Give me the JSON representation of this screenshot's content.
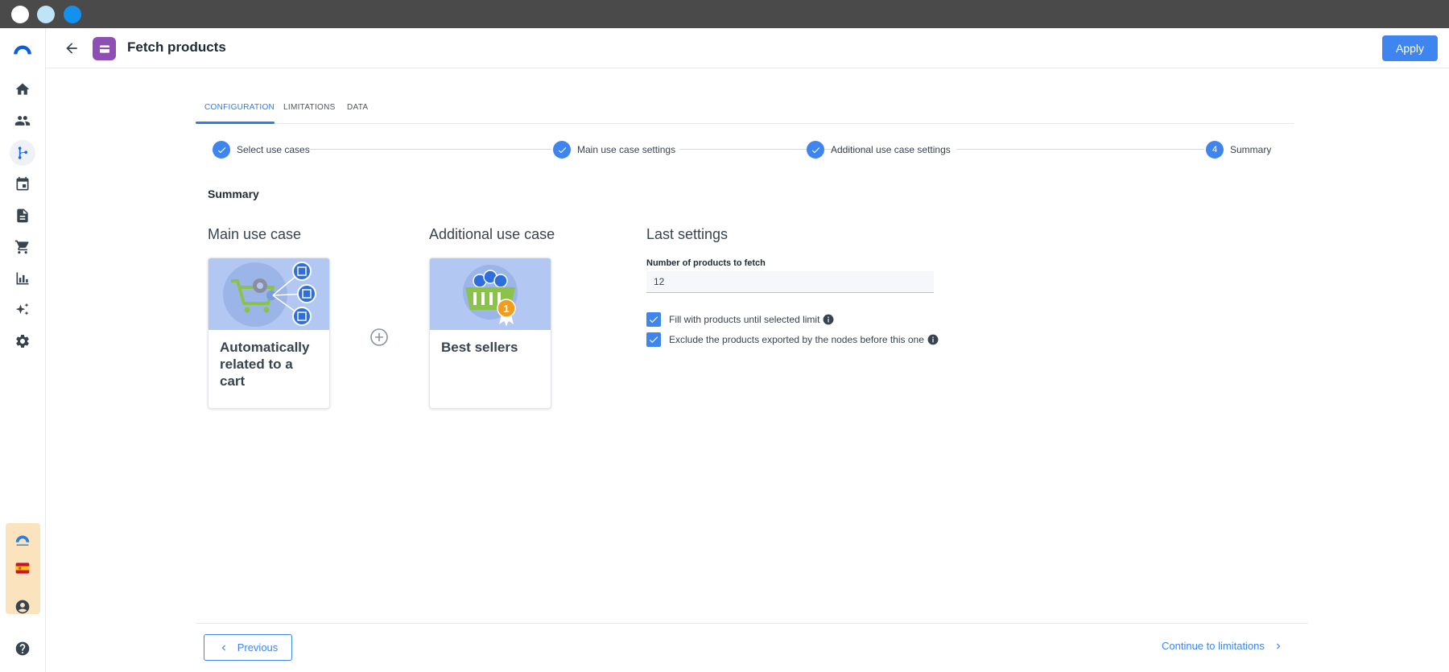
{
  "header": {
    "title": "Fetch products",
    "apply_label": "Apply"
  },
  "tabs": [
    {
      "label": "CONFIGURATION"
    },
    {
      "label": "LIMITATIONS"
    },
    {
      "label": "DATA"
    }
  ],
  "stepper": {
    "steps": [
      {
        "label": "Select use cases",
        "status": "done"
      },
      {
        "label": "Main use case settings",
        "status": "done"
      },
      {
        "label": "Additional use case settings",
        "status": "done"
      },
      {
        "label": "Summary",
        "status": "current",
        "number": "4"
      }
    ]
  },
  "summary": {
    "title": "Summary",
    "main": {
      "title": "Main use case",
      "card_label": "Automatically related to a cart"
    },
    "additional": {
      "title": "Additional use case",
      "card_label": "Best sellers"
    },
    "last_settings": {
      "title": "Last settings",
      "field_label": "Number of products to fetch",
      "field_value": "12",
      "checkboxes": [
        {
          "label": "Fill with products until selected limit",
          "checked": true
        },
        {
          "label": "Exclude the products exported by the nodes before this one",
          "checked": true
        }
      ]
    }
  },
  "footer": {
    "previous_label": "Previous",
    "continue_label": "Continue to limitations"
  },
  "colors": {
    "accent": "#3e85f0",
    "node_badge": "#8e4fb5",
    "card_image_bg": "#b2c8f2",
    "brand_panel": "#fbe3bd"
  },
  "icons": {
    "sidebar": [
      "logo-icon",
      "home-icon",
      "people-icon",
      "workflow-icon",
      "calendar-icon",
      "document-icon",
      "cart-icon",
      "chart-icon",
      "sparkle-icon",
      "gear-icon",
      "brand-logo-icon",
      "flag-icon",
      "account-icon",
      "help-icon"
    ]
  }
}
